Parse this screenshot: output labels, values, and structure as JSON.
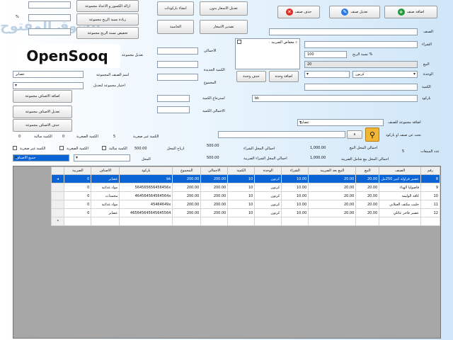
{
  "top_buttons": {
    "add_item": "اضافة صنف",
    "edit_item": "تعديل صنف",
    "delete_item": "حذف صنف",
    "edit_prices_no_change": "تعديل الاسعار بدون",
    "print_prices": "تصدير الاسعار",
    "create_barcodes": "انشاء باركودات",
    "calculator": "الحاسبة",
    "remove_fractions": "ازالة الكسور و الاعداد مجموعة",
    "increase_profit": "زيادة نسبة الربح مجموعة",
    "reduce_profit": "تخفيض نسبة الربح مجموعة"
  },
  "form": {
    "item_label": "الصنف",
    "purchase_label": "الشراء",
    "profit_pct_label": "نسبة الربح %",
    "profit_pct_value": "100",
    "sale_label": "البيع",
    "sale_value": "20",
    "unit_label": "الوحدة",
    "unit_value": "كرتون",
    "quantity_label": "الكمية",
    "barcode_label": "باركود",
    "barcode_value": "bk",
    "tax_checkbox": "معفاض الضريبة ٠ ٪",
    "add_unit": "اضافة وحدة",
    "delete_unit": "حذف وحدة",
    "total_label": "الاجمالي",
    "new_qty_label": "الكمية الجديدة",
    "sum_label": "المجموع",
    "retrieve_qty": "استرجاع الكمية",
    "total_qty": "الاجمالي الكمية",
    "percent_sign": "%",
    "edit_group": "تعديل مجموعة",
    "group_name_label": "اسم الصنف المجموعة",
    "group_name_value": "عصاير",
    "choose_group_label": "اختيار مجموعة لتعديل",
    "add_group_items": "اضافة الاصناف مجموعة",
    "edit_group_items": "تعديل الاصناف مجموعة",
    "delete_group_items": "حذف الاصناف مجموعة",
    "add_group_to_item": "اضافة مجموعة للصنف",
    "group_select_value": "عصاير",
    "search_button": "بحث عن صنف او باركود",
    "search_clear": "x"
  },
  "stats": {
    "qty_not_small": "الكمية غير صغرية",
    "qty_not_small_val": "5",
    "qty_small": "الكمية الصغرية",
    "qty_small_val": "0",
    "qty_negative": "الكمية سالبة",
    "qty_negative_val": "0",
    "profit_label": "ارباح المحل",
    "profit_val": "500.00",
    "store_label": "المحل",
    "store_val": "500.00",
    "purchase_total_label": "احمالي المحل الشراء",
    "purchase_total_val": "500.00",
    "purchase_tax_label": "احمالي المحل الشراء الضريبة",
    "purchase_tax_val": "500.00",
    "sale_total_label": "احمالي المحل البيع",
    "sale_total_val": "1,000.00",
    "sale_tax_label": "احمالي المحل بيع شامل الضريبة",
    "sale_tax_val": "1,000.00",
    "sales_count_label": "عدد المبيعات",
    "sales_count_val": "5",
    "filter_not_small": "الكمية غير صغرية",
    "filter_small": "الكمية الصغرية",
    "filter_negative": "الكمية سالبة",
    "filter_all": "جميع الاصناف"
  },
  "watermark": "السوق المفتوح",
  "logo": "OpenSooq",
  "colors": {
    "selection": "#0a64d6",
    "add_icon": "#1f9a3c",
    "edit_icon": "#2a7be0",
    "delete_icon": "#d93025",
    "search_button": "#f2b632"
  },
  "grid": {
    "columns": [
      "رقم",
      "الصنف",
      "البيع",
      "البيع بعد الضريبة",
      "الشراء",
      "الوحدة",
      "الكمية",
      "الاجمالي",
      "المجموع",
      "باركود",
      "الاصناف",
      "الضريبة"
    ],
    "rows": [
      [
        "8",
        "عصير فراولة كبير 250مل",
        "20.00",
        "20.00",
        "10.00",
        "كرتون",
        "10",
        "200.00",
        "200.00",
        "bk",
        "عصاير",
        "0"
      ],
      [
        "9",
        "فاصوليا الهناء",
        "20.00",
        "20.00",
        "10.00",
        "كرتون",
        "10",
        "200.00",
        "200.00",
        "564565656456456x",
        "مواد غذائية",
        "0"
      ],
      [
        "10",
        "كافة الوليمة",
        "20.00",
        "20.00",
        "10.00",
        "كرتون",
        "10",
        "200.00",
        "200.00",
        "464564564564564x",
        "مجمدات",
        "0"
      ],
      [
        "11",
        "حليب مكثف العيلاني",
        "20.00",
        "20.00",
        "10.00",
        "كرتون",
        "10",
        "200.00",
        "200.00",
        "45464649x",
        "مواد غذائية",
        "0"
      ],
      [
        "12",
        "عصير فاخر عائلي",
        "20.00",
        "20.00",
        "10.00",
        "كرتون",
        "10",
        "200.00",
        "200.00",
        "465645645645645564",
        "عصاير",
        "0"
      ]
    ]
  }
}
